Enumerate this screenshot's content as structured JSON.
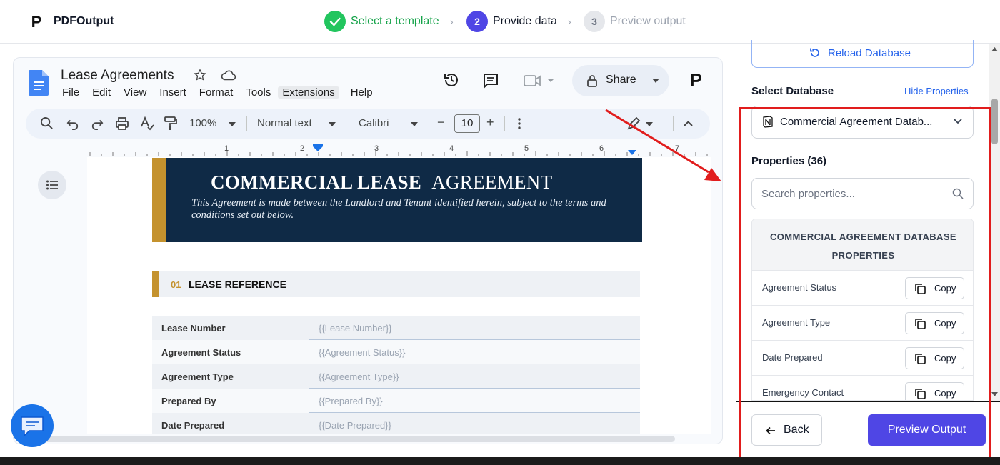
{
  "app": {
    "name": "PDFOutput",
    "logo_letter": "P"
  },
  "steps": [
    {
      "number": "",
      "label": "Select a template",
      "state": "done"
    },
    {
      "number": "2",
      "label": "Provide data",
      "state": "active"
    },
    {
      "number": "3",
      "label": "Preview output",
      "state": "pending"
    }
  ],
  "colors": {
    "accent": "#4f46e5",
    "success": "#22c55e",
    "link": "#2563eb",
    "highlight": "#e11d1d",
    "doc_navy": "#0f2a46",
    "doc_gold": "#c4922e"
  },
  "gdoc": {
    "title": "Lease Agreements",
    "menu": [
      "File",
      "Edit",
      "View",
      "Insert",
      "Format",
      "Tools",
      "Extensions",
      "Help"
    ],
    "share_label": "Share",
    "profile_letter": "P",
    "toolbar": {
      "zoom": "100%",
      "style": "Normal text",
      "font": "Calibri",
      "font_size": "10",
      "minus": "−",
      "plus": "+"
    },
    "ruler_numbers": [
      "1",
      "2",
      "3",
      "4",
      "5",
      "6",
      "7"
    ],
    "doc": {
      "hero_title_bold": "COMMERCIAL LEASE",
      "hero_title_rest": "AGREEMENT",
      "hero_subtitle": "This Agreement is made between the Landlord and Tenant identified herein, subject to the terms and conditions set out below.",
      "section_number": "01",
      "section_title": "LEASE REFERENCE",
      "rows": [
        {
          "label": "Lease Number",
          "value": "{{Lease Number}}"
        },
        {
          "label": "Agreement Status",
          "value": "{{Agreement Status}}"
        },
        {
          "label": "Agreement Type",
          "value": "{{Agreement Type}}"
        },
        {
          "label": "Prepared By",
          "value": "{{Prepared By}}"
        },
        {
          "label": "Date Prepared",
          "value": "{{Date Prepared}}"
        }
      ]
    }
  },
  "panel": {
    "reload_label": "Reload Database",
    "select_db_label": "Select Database",
    "hide_props_label": "Hide Properties",
    "selected_db": "Commercial Agreement Datab...",
    "props_count_label": "Properties (36)",
    "search_placeholder": "Search properties...",
    "table_header": "COMMERCIAL AGREEMENT DATABASE PROPERTIES",
    "properties": [
      {
        "name": "Agreement Status",
        "copy": "Copy"
      },
      {
        "name": "Agreement Type",
        "copy": "Copy"
      },
      {
        "name": "Date Prepared",
        "copy": "Copy"
      },
      {
        "name": "Emergency Contact",
        "copy": "Copy"
      }
    ],
    "back_label": "Back",
    "preview_label": "Preview Output"
  }
}
